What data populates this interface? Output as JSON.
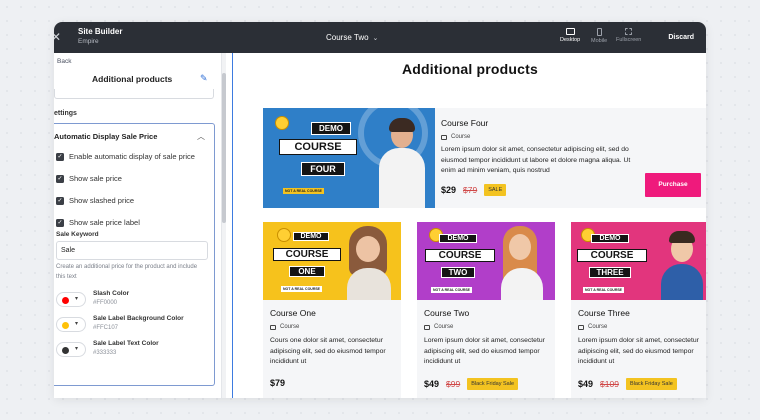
{
  "topbar": {
    "title": "Site Builder",
    "subtitle": "Empire",
    "page_selector": "Course Two",
    "devices": [
      "Desktop",
      "Mobile",
      "Fullscreen"
    ],
    "discard": "Discard"
  },
  "panel": {
    "back": "Back",
    "title": "Additional products",
    "settings_label": "ettings",
    "section_title": "Automatic Display Sale Price",
    "checkboxes": [
      "Enable automatic display of sale price",
      "Show sale price",
      "Show slashed price",
      "Show sale price label"
    ],
    "keyword_label": "Sale Keyword",
    "keyword_value": "Sale",
    "keyword_help": "Create an additional price for the product and include this text",
    "colors": [
      {
        "name": "Slash Color",
        "hex": "#FF0000",
        "swatch": "#ff0000"
      },
      {
        "name": "Sale Label Background Color",
        "hex": "#FFC107",
        "swatch": "#ffc107"
      },
      {
        "name": "Sale Label Text Color",
        "hex": "#333333",
        "swatch": "#333333"
      }
    ]
  },
  "preview": {
    "heading": "Additional products",
    "featured": {
      "title": "Course Four",
      "tag": "Course",
      "description": "Lorem ipsum dolor sit amet, consectetur adipiscing elit, sed do eiusmod tempor incididunt ut labore et dolore magna aliqua. Ut enim ad minim veniam, quis nostrud",
      "price": "$29",
      "slashed": "$79",
      "badge": "SALE",
      "button": "Purchase",
      "thumb": {
        "line1": "DEMO",
        "line2": "COURSE",
        "line3": "FOUR",
        "note": "NOT A REAL COURSE"
      }
    },
    "cards": [
      {
        "title": "Course One",
        "tag": "Course",
        "description": "Cours one dolor sit amet, consectetur adipiscing elit, sed do eiusmod tempor incididunt ut",
        "price": "$79",
        "slashed": "",
        "badge": "",
        "thumb": {
          "line1": "DEMO",
          "line2": "COURSE",
          "line3": "ONE",
          "note": "NOT A REAL COURSE"
        }
      },
      {
        "title": "Course Two",
        "tag": "Course",
        "description": "Lorem ipsum dolor sit amet, consectetur adipiscing elit, sed do eiusmod tempor incididunt ut",
        "price": "$49",
        "slashed": "$99",
        "badge": "Black Friday Sale",
        "thumb": {
          "line1": "DEMO",
          "line2": "COURSE",
          "line3": "TWO",
          "note": "NOT A REAL COURSE"
        }
      },
      {
        "title": "Course Three",
        "tag": "Course",
        "description": "Lorem ipsum dolor sit amet, consectetur adipiscing elit, sed do eiusmod tempor incididunt ut",
        "price": "$49",
        "slashed": "$109",
        "badge": "Black Friday Sale",
        "thumb": {
          "line1": "DEMO",
          "line2": "COURSE",
          "line3": "THREE",
          "note": "NOT A REAL COURSE"
        }
      }
    ]
  },
  "colors": {
    "topbar": "#2b2f36",
    "accent_blue": "#3d7be0",
    "purchase_pink": "#ef1a7c",
    "sale_yellow": "#f3c321",
    "slash_red": "#d04848"
  }
}
